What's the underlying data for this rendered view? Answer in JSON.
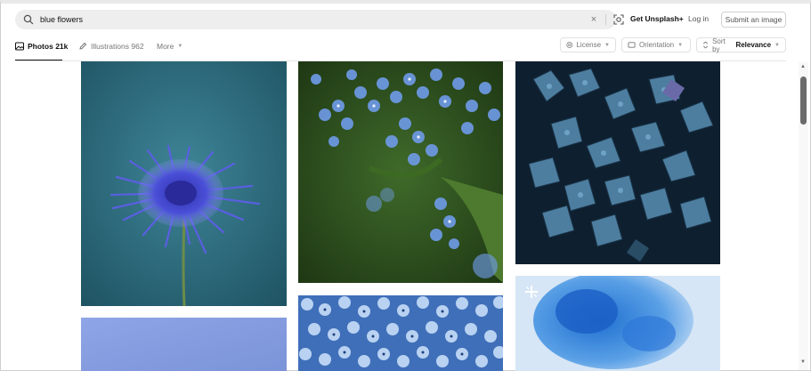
{
  "search": {
    "value": "blue flowers",
    "icon": "search-icon",
    "clear_icon": "×"
  },
  "nav": {
    "get_unsplash": "Get Unsplash+",
    "login": "Log in",
    "submit": "Submit an image"
  },
  "tabs": [
    {
      "label": "Photos",
      "count": "21k"
    },
    {
      "label": "Illustrations",
      "count": "962"
    },
    {
      "label": "More",
      "count": ""
    }
  ],
  "filters": {
    "license": "License",
    "orientation": "Orientation",
    "sort_prefix": "Sort by",
    "sort_value": "Relevance"
  },
  "photos": [
    {
      "subject": "purple-blue chrysanthemum on teal background"
    },
    {
      "subject": "blue forget-me-not flowers"
    },
    {
      "subject": "blue hydrangea petals dark"
    },
    {
      "subject": "light blue gradient"
    },
    {
      "subject": "field of small light blue flowers"
    },
    {
      "subject": "blurred blue hydrangea"
    }
  ],
  "colors": {
    "accent": "#111111",
    "muted": "#767676",
    "search_bg": "#eeeeee"
  }
}
